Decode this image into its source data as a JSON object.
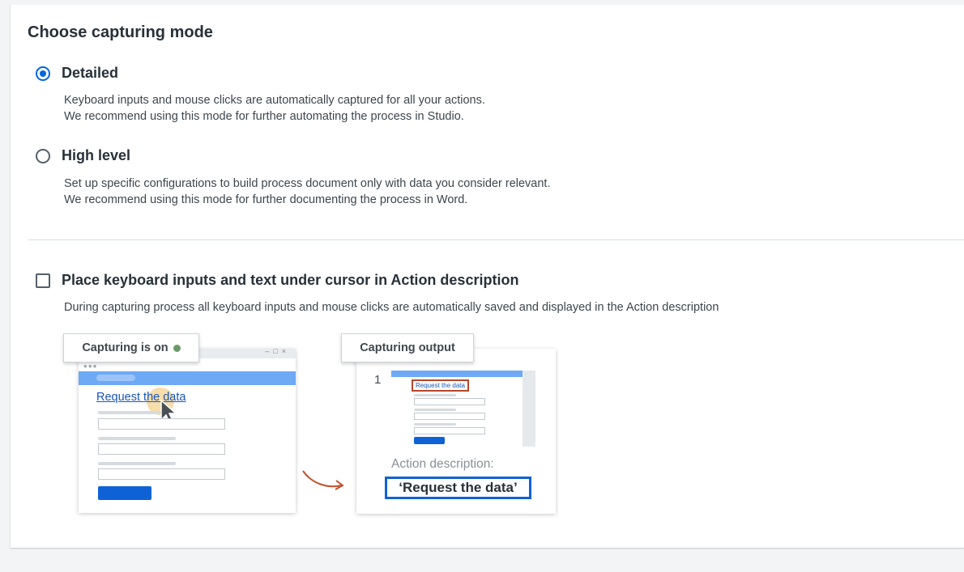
{
  "section_title": "Choose capturing mode",
  "options": [
    {
      "label": "Detailed",
      "checked": true,
      "desc_line1": "Keyboard inputs and mouse clicks are automatically captured for all your actions.",
      "desc_line2": "We recommend using this mode for further automating the process in Studio."
    },
    {
      "label": "High level",
      "checked": false,
      "desc_line1": "Set up specific configurations to build process document only with data you consider relevant.",
      "desc_line2": "We recommend using this mode for further documenting the process in Word."
    }
  ],
  "checkbox_option": {
    "label": "Place keyboard inputs and text under cursor in Action description",
    "checked": false,
    "description": "During capturing process all keyboard inputs and mouse clicks are automatically saved and displayed in the Action description"
  },
  "illustration": {
    "capturing_tag": "Capturing is on",
    "status_dot_color": "#6a9a6a",
    "browser_link": "Request the data",
    "output_tag": "Capturing output",
    "step_number": "1",
    "thumb_link": "Request the data",
    "action_label": "Action description:",
    "action_value": "‘Request the data’",
    "arrow_color": "#c0532e",
    "accent_color": "#0f62d6"
  }
}
